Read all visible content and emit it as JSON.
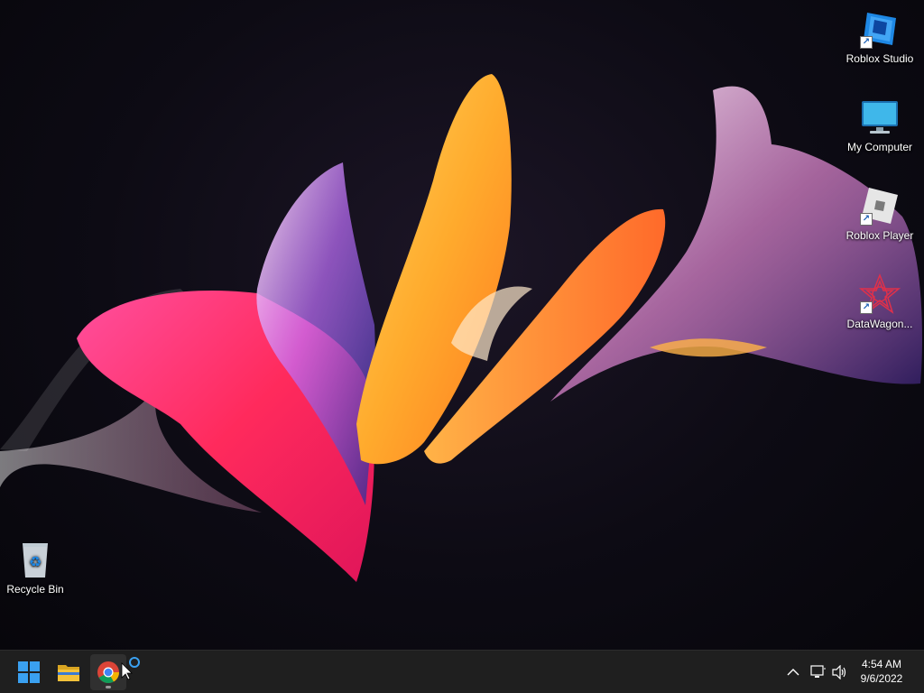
{
  "desktop": {
    "icons": [
      {
        "label": "Roblox Studio",
        "icon": "roblox-studio-icon",
        "shortcut": true
      },
      {
        "label": "My Computer",
        "icon": "monitor-icon",
        "shortcut": false
      },
      {
        "label": "Roblox Player",
        "icon": "roblox-player-icon",
        "shortcut": true
      },
      {
        "label": "DataWagon...",
        "icon": "datawagon-icon",
        "shortcut": true
      },
      {
        "label": "Recycle Bin",
        "icon": "recycle-bin-icon",
        "shortcut": false
      }
    ]
  },
  "taskbar": {
    "apps": [
      {
        "name": "Start",
        "icon": "windows-start-icon"
      },
      {
        "name": "File Explorer",
        "icon": "folder-icon"
      },
      {
        "name": "Google Chrome",
        "icon": "chrome-icon",
        "active": true
      }
    ],
    "tray": {
      "icons": [
        "chevron-up-icon",
        "network-icon",
        "volume-icon"
      ]
    },
    "clock": {
      "time": "4:54 AM",
      "date": "9/6/2022"
    }
  },
  "colors": {
    "taskbar": "#1f1f1f",
    "desktop_bg": "#0d0b14",
    "windows_blue": "#3aa0f0",
    "folder_yellow": "#f3c13a"
  }
}
